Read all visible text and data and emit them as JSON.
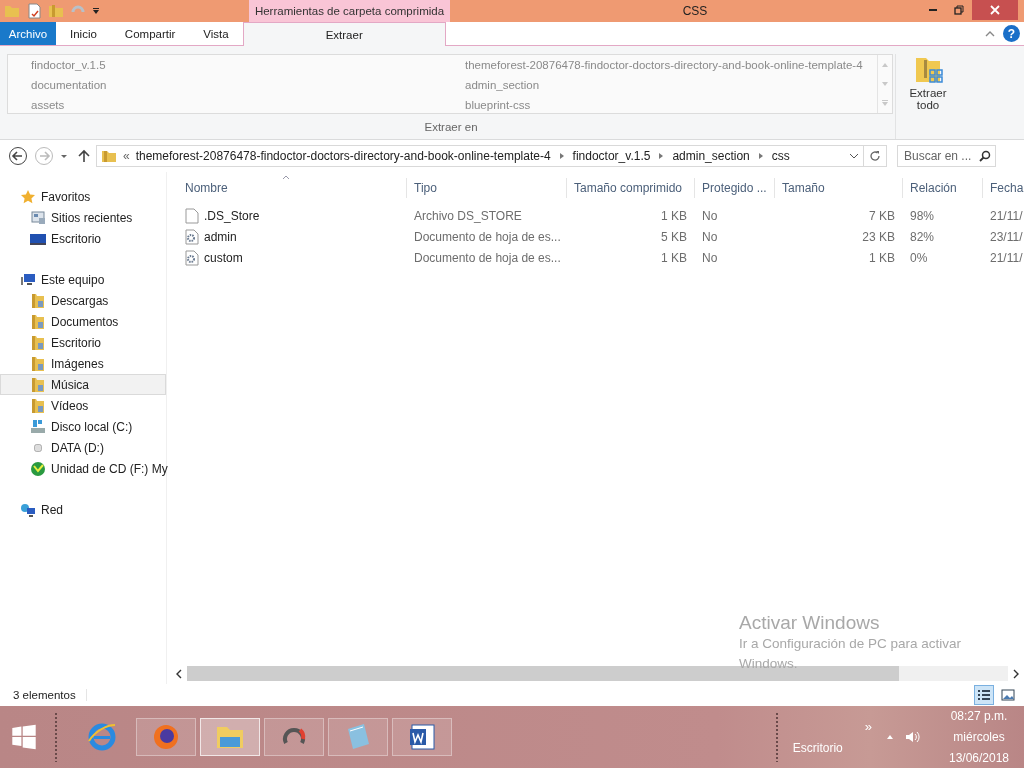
{
  "window": {
    "title": "CSS",
    "contextual_header": "Herramientas de carpeta comprimida"
  },
  "ribbon": {
    "tabs": [
      {
        "label": "Archivo",
        "kind": "file",
        "selected": false
      },
      {
        "label": "Inicio",
        "kind": "tab",
        "selected": false
      },
      {
        "label": "Compartir",
        "kind": "tab",
        "selected": false
      },
      {
        "label": "Vista",
        "kind": "tab",
        "selected": false
      },
      {
        "label": "Extraer",
        "kind": "contextual",
        "selected": true
      }
    ],
    "help_button": "?",
    "extract_locations": [
      {
        "label": "findoctor_v.1.5"
      },
      {
        "label": "documentation"
      },
      {
        "label": "assets"
      },
      {
        "label": "themeforest-20876478-findoctor-doctors-directory-and-book-online-template-4"
      },
      {
        "label": "admin_section"
      },
      {
        "label": "blueprint-css"
      }
    ],
    "extract_all_button": [
      "Extraer",
      "todo"
    ],
    "group_label": "Extraer en"
  },
  "address_bar": {
    "overflow_marker": "«",
    "path": [
      "themeforest-20876478-findoctor-doctors-directory-and-book-online-template-4",
      "findoctor_v.1.5",
      "admin_section",
      "css"
    ],
    "search_placeholder": "Buscar en ..."
  },
  "navigation": [
    {
      "label": "Favoritos",
      "kind": "star",
      "selected": false,
      "children": [
        {
          "label": "Sitios recientes",
          "kind": "recent",
          "selected": false
        },
        {
          "label": "Escritorio",
          "kind": "monitor",
          "selected": false
        }
      ]
    },
    {
      "label": "Este equipo",
      "kind": "computer",
      "selected": false,
      "children": [
        {
          "label": "Descargas",
          "kind": "folder",
          "selected": false
        },
        {
          "label": "Documentos",
          "kind": "folder",
          "selected": false
        },
        {
          "label": "Escritorio",
          "kind": "folder",
          "selected": false
        },
        {
          "label": "Imágenes",
          "kind": "folder",
          "selected": false
        },
        {
          "label": "Música",
          "kind": "folder",
          "selected": true
        },
        {
          "label": "Vídeos",
          "kind": "folder",
          "selected": false
        },
        {
          "label": "Disco local (C:)",
          "kind": "disk",
          "selected": false
        },
        {
          "label": "DATA (D:)",
          "kind": "drive",
          "selected": false
        },
        {
          "label": "Unidad de CD (F:) My",
          "kind": "disc",
          "selected": false
        }
      ]
    },
    {
      "label": "Red",
      "kind": "network",
      "selected": false
    }
  ],
  "table": {
    "columns": [
      "Nombre",
      "Tipo",
      "Tamaño comprimido",
      "Protegido ...",
      "Tamaño",
      "Relación",
      "Fecha"
    ],
    "rows": [
      {
        "kind": "file",
        "name": ".DS_Store",
        "type": "Archivo DS_STORE",
        "compressed": "1 KB",
        "protected": "No",
        "size": "7 KB",
        "ratio": "98%",
        "date": "21/11/"
      },
      {
        "kind": "stylesheet",
        "name": "admin",
        "type": "Documento de hoja de es...",
        "compressed": "5 KB",
        "protected": "No",
        "size": "23 KB",
        "ratio": "82%",
        "date": "23/11/"
      },
      {
        "kind": "stylesheet",
        "name": "custom",
        "type": "Documento de hoja de es...",
        "compressed": "1 KB",
        "protected": "No",
        "size": "1 KB",
        "ratio": "0%",
        "date": "21/11/"
      }
    ]
  },
  "activation_notice": {
    "title": "Activar Windows",
    "text": "Ir a Configuración de PC para activar Windows."
  },
  "status_bar": {
    "count": "3 elementos"
  },
  "taskbar": {
    "apps": [
      {
        "kind": "browser-e",
        "active": false
      },
      {
        "kind": "browser-fox",
        "active": false
      },
      {
        "kind": "explorer",
        "active": true
      },
      {
        "kind": "ring",
        "active": false
      },
      {
        "kind": "notepad",
        "active": false
      },
      {
        "kind": "word",
        "active": false
      }
    ],
    "toolbar_label": "Escritorio",
    "overflow": "»",
    "clock": {
      "time": "08:27 p.m.",
      "day": "miércoles",
      "date": "13/06/2018"
    }
  }
}
